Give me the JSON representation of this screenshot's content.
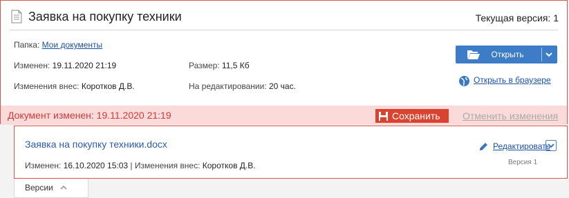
{
  "document": {
    "title": "Заявка на покупку техники",
    "current_version": "Текущая версия: 1",
    "folder_label": "Папка:",
    "folder_link": "Мои документы",
    "changed_label": "Изменен:",
    "changed_value": "19.11.2020 21:19",
    "changed_by_label": "Изменения внес:",
    "changed_by_value": "Коротков Д.В.",
    "size_label": "Размер:",
    "size_value": "11,5 Кб",
    "editing_label": "На редактировании:",
    "editing_value": "20 час.",
    "open_button": "Открыть",
    "open_in_browser": "Открыть в браузере"
  },
  "alert": {
    "text": "Документ изменен: 19.11.2020 21:19",
    "save_button": "Сохранить",
    "cancel_link": "Отменить изменения"
  },
  "file": {
    "name": "Заявка на покупку техники.docx",
    "changed_label": "Изменен:",
    "changed_value": "16.10.2020 15:03",
    "separator": "|",
    "changed_by_label": "Изменения внес:",
    "changed_by_value": "Коротков Д.В.",
    "edit_link": "Редактировать",
    "version": "Версия 1"
  },
  "versions_tab": {
    "label": "Версии"
  },
  "colors": {
    "accent": "#3d7dc8",
    "alert_bg": "#fbdada",
    "alert_text": "#d23a3a",
    "save_bg": "#d9432f",
    "border": "#d9534f"
  }
}
